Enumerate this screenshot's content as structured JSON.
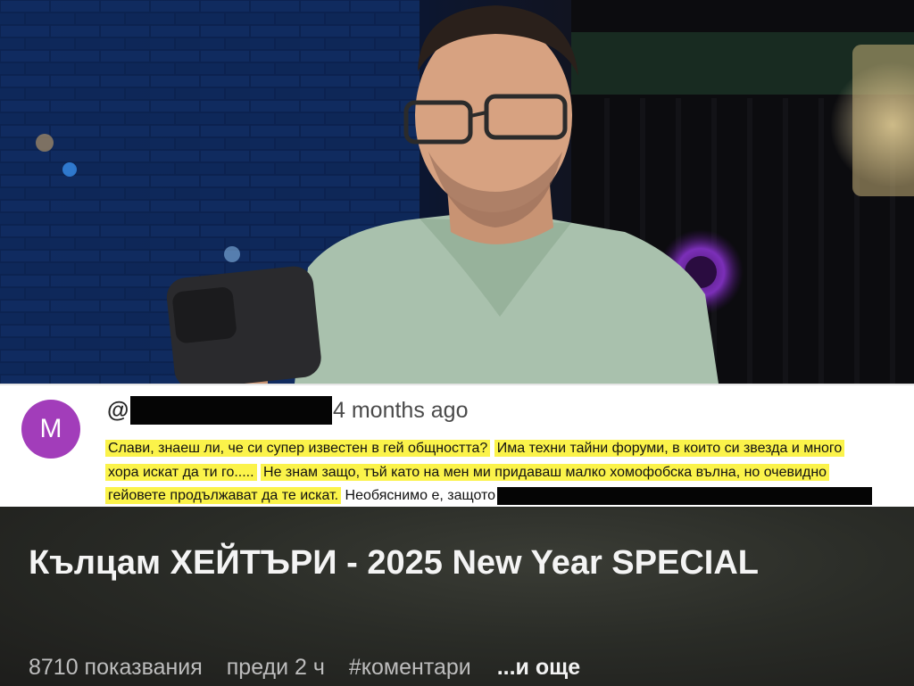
{
  "video": {
    "frame_description_icon": "video-frame"
  },
  "comment": {
    "avatar_letter": "M",
    "handle_prefix": "@",
    "timestamp": "4 months ago",
    "highlight_1": "Слави, знаеш ли, че си супер известен в гей общността?",
    "highlight_2": "Има техни тайни форуми, в които си звезда и много",
    "highlight_3": "хора искат да ти го.....",
    "highlight_4": "Не знам защо, тъй като на мен ми придаваш малко хомофобска вълна, но очевидно",
    "highlight_5": "гейовете продължават да те искат.",
    "plain_tail": "Необяснимо е, защото"
  },
  "title_card": {
    "title": "Кълцам ХЕЙТЪРИ - 2025 New Year SPECIAL",
    "views": "8710 показвания",
    "age": "преди 2 ч",
    "hashtag": "#коментари",
    "more": "...и още"
  },
  "colors": {
    "avatar": "#a23dba",
    "highlight": "#fbf34a",
    "redaction": "#050505"
  }
}
